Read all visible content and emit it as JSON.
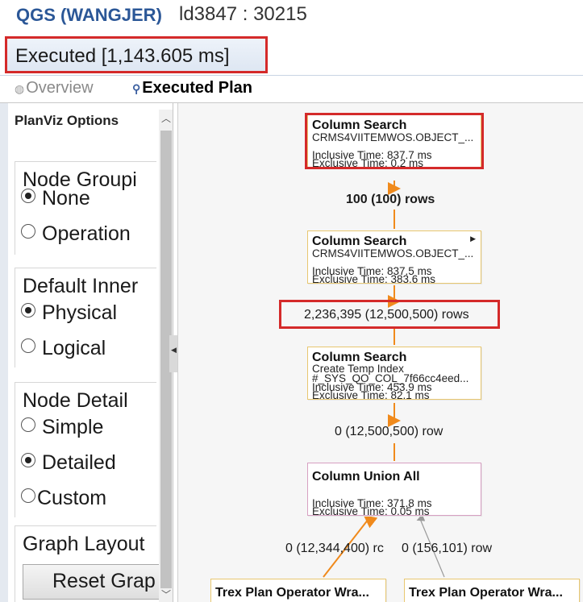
{
  "window": {
    "system": "QGS (WANGJER)",
    "session": "ld3847 : 30215"
  },
  "editor_tab": {
    "label": "Executed [1,143.605 ms]"
  },
  "subtabs": [
    {
      "label": "Overview",
      "icon": "overview-icon"
    },
    {
      "label": "Executed Plan",
      "icon": "plan-icon"
    }
  ],
  "sidebar": {
    "header": "PlanViz Options",
    "node_grouping": {
      "title": "Node Groupi",
      "options": [
        {
          "label": "None",
          "selected": true
        },
        {
          "label": "Operation",
          "selected": false
        }
      ]
    },
    "default_inner": {
      "title": "Default Inner",
      "options": [
        {
          "label": "Physical",
          "selected": true
        },
        {
          "label": "Logical",
          "selected": false
        }
      ]
    },
    "node_detail": {
      "title": "Node Detail",
      "options": [
        {
          "label": "Simple",
          "selected": false
        },
        {
          "label": "Detailed",
          "selected": true
        },
        {
          "label": "Custom",
          "selected": false
        }
      ]
    },
    "graph_layout": {
      "title": "Graph Layout",
      "reset_label": "Reset Grap"
    }
  },
  "plan": {
    "nodes": [
      {
        "title": "Column Search",
        "lines": [
          "CRMS4VIITEMWOS.OBJECT_...",
          "Inclusive Time: 837.7 ms",
          "Exclusive Time: 0.2 ms"
        ]
      },
      {
        "title": "Column Search",
        "lines": [
          "CRMS4VIITEMWOS.OBJECT_...",
          "Inclusive Time: 837.5 ms",
          "Exclusive Time: 383.6 ms"
        ]
      },
      {
        "title": "Column Search",
        "lines": [
          "Create Temp Index",
          "#_SYS_QO_COL_7f66cc4eed...",
          "Inclusive Time: 453.9 ms",
          "Exclusive Time: 82.1 ms"
        ]
      },
      {
        "title": "Column Union All",
        "lines": [
          "Inclusive Time: 371.8 ms",
          "Exclusive Time: 0.05 ms"
        ]
      },
      {
        "title": "Trex Plan Operator Wra..."
      },
      {
        "title": "Trex Plan Operator Wra..."
      }
    ],
    "edges": [
      {
        "label": "100 (100) rows"
      },
      {
        "label": "2,236,395 (12,500,500) rows"
      },
      {
        "label": "0 (12,500,500) row"
      },
      {
        "label": "0 (12,344,400) rc"
      },
      {
        "label": "0 (156,101) row"
      }
    ]
  },
  "colors": {
    "highlight": "#d42a2a",
    "edge_orange": "#f08a1c",
    "node_border": "#e8c770",
    "title_blue": "#2b5797"
  }
}
